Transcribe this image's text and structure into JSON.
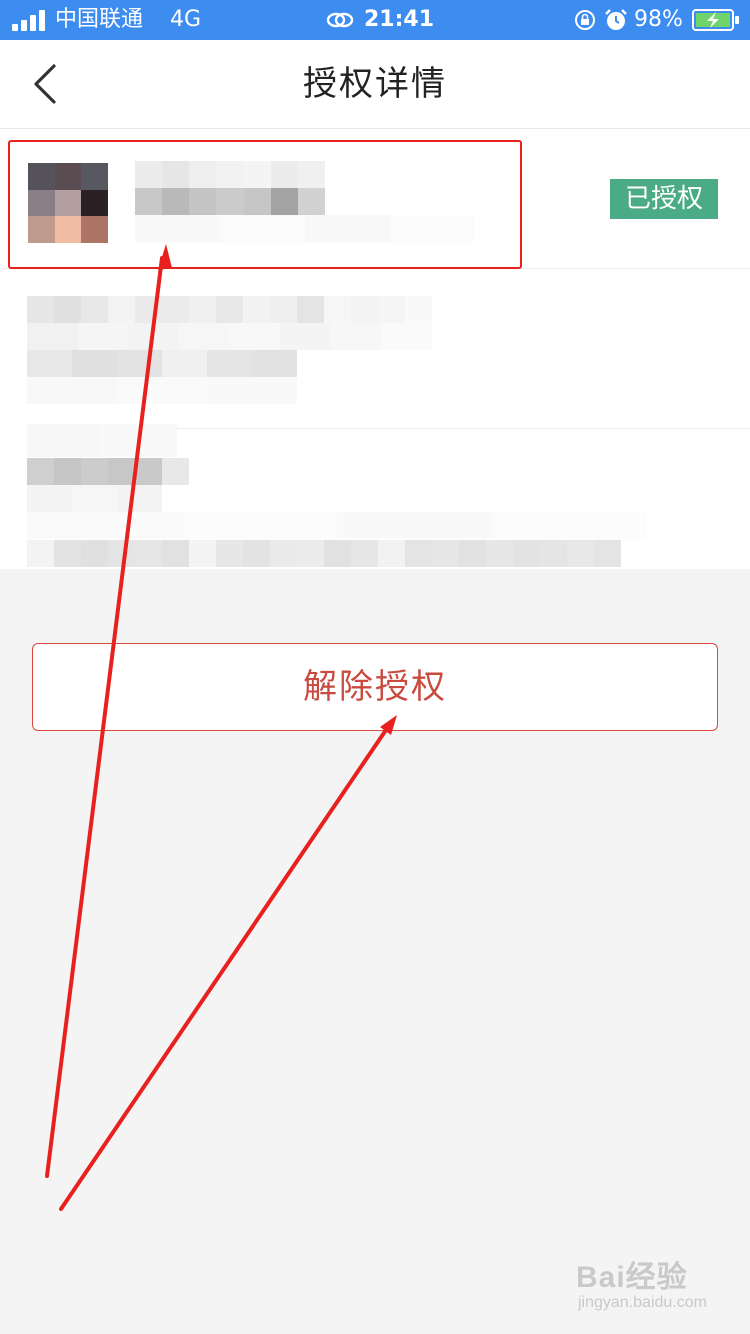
{
  "status_bar": {
    "carrier": "中国联通",
    "network": "4G",
    "time": "21:41",
    "battery": "98%",
    "icons": [
      "signal-icon",
      "link-icon",
      "rotation-lock-icon",
      "alarm-icon",
      "battery-charging-icon"
    ],
    "bg_color": "#3d8cf0"
  },
  "nav": {
    "title": "授权详情",
    "back_icon": "chevron-left-icon"
  },
  "app": {
    "status_badge": "已授权",
    "badge_color": "#4cab87"
  },
  "actions": {
    "unauthorize_label": "解除授权",
    "accent_color": "#d9473e"
  },
  "watermark": {
    "brand": "Bai经验",
    "url": "jingyan.baidu.com"
  }
}
